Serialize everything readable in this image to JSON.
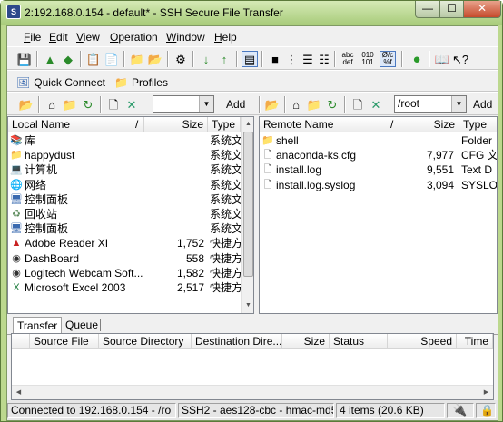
{
  "window": {
    "title": "2:192.168.0.154 - default* - SSH Secure File Transfer",
    "minimize_icon": "minimize-icon",
    "maximize_icon": "maximize-icon",
    "close_icon": "close-icon"
  },
  "menu": [
    {
      "label": "File",
      "key": "F"
    },
    {
      "label": "Edit",
      "key": "E"
    },
    {
      "label": "View",
      "key": "V"
    },
    {
      "label": "Operation",
      "key": "O"
    },
    {
      "label": "Window",
      "key": "W"
    },
    {
      "label": "Help",
      "key": "H"
    }
  ],
  "quick_connect": {
    "label": "Quick Connect"
  },
  "profiles": {
    "label": "Profiles"
  },
  "local_bar": {
    "path_value": "",
    "add_label": "Add"
  },
  "remote_bar": {
    "path_value": "/root",
    "add_label": "Add"
  },
  "toolbar_text": {
    "abc_top": "abc",
    "abc_bottom": "def",
    "bin_top": "010",
    "bin_bottom": "101",
    "auto_top": "Ø/c",
    "auto_bottom": "%f"
  },
  "local": {
    "headers": {
      "name": "Local Name",
      "sort": "/",
      "size": "Size",
      "type": "Type"
    },
    "rows": [
      {
        "name": "库",
        "size": "",
        "type": "系统文",
        "icon": "library-icon"
      },
      {
        "name": "happydust",
        "size": "",
        "type": "系统文",
        "icon": "user-folder-icon"
      },
      {
        "name": "计算机",
        "size": "",
        "type": "系统文",
        "icon": "computer-icon"
      },
      {
        "name": "网络",
        "size": "",
        "type": "系统文",
        "icon": "network-icon"
      },
      {
        "name": "控制面板",
        "size": "",
        "type": "系统文",
        "icon": "control-panel-icon"
      },
      {
        "name": "回收站",
        "size": "",
        "type": "系统文",
        "icon": "recycle-bin-icon"
      },
      {
        "name": "控制面板",
        "size": "",
        "type": "系统文",
        "icon": "control-panel-icon"
      },
      {
        "name": "Adobe Reader XI",
        "size": "1,752",
        "type": "快捷方",
        "icon": "adobe-reader-icon"
      },
      {
        "name": "DashBoard",
        "size": "558",
        "type": "快捷方",
        "icon": "dashboard-icon"
      },
      {
        "name": "Logitech Webcam Soft...",
        "size": "1,582",
        "type": "快捷方",
        "icon": "webcam-icon"
      },
      {
        "name": "Microsoft Excel 2003",
        "size": "2,517",
        "type": "快捷方",
        "icon": "excel-icon"
      }
    ]
  },
  "remote": {
    "headers": {
      "name": "Remote Name",
      "sort": "/",
      "size": "Size",
      "type": "Type"
    },
    "rows": [
      {
        "name": "shell",
        "size": "",
        "type": "Folder",
        "icon": "folder-icon"
      },
      {
        "name": "anaconda-ks.cfg",
        "size": "7,977",
        "type": "CFG 文",
        "icon": "file-icon"
      },
      {
        "name": "install.log",
        "size": "9,551",
        "type": "Text D",
        "icon": "file-icon"
      },
      {
        "name": "install.log.syslog",
        "size": "3,094",
        "type": "SYSLO",
        "icon": "file-icon"
      }
    ]
  },
  "transfer": {
    "tabs": [
      "Transfer",
      "Queue"
    ],
    "headers": [
      "Source File",
      "Source Directory",
      "Destination Dire...",
      "Size",
      "Status",
      "Speed",
      "Time"
    ]
  },
  "status": {
    "connected": "Connected to 192.168.0.154 - /ro",
    "cipher": "SSH2 - aes128-cbc - hmac-md5",
    "items": "4 items (20.6 KB)"
  }
}
